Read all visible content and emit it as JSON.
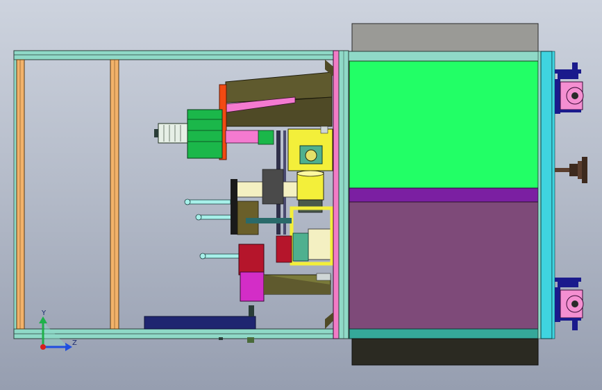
{
  "view": {
    "background_top": "#cdd3de",
    "background_bottom": "#969eb0"
  },
  "triad": {
    "y_label": "Y",
    "z_label": "Z",
    "colors": {
      "y_axis": "#1fb14a",
      "z_axis": "#1f4fe0",
      "origin": "#d81e1e"
    }
  },
  "palette": {
    "frame": "#8fd9c7",
    "frame_outline": "#2a3d38",
    "posts": "#f2b26a",
    "cabinet_green": "#22ff66",
    "cabinet_purple": "#7e4a79",
    "cabinet_violet": "#7b1fa2",
    "cabinet_dark": "#2b2a22",
    "cabinet_grey": "#9a9a96",
    "mounting_plate_pink": "#f27cc6",
    "mounting_plate_teal": "#3fd4e0",
    "caster_navy": "#1a1a8c",
    "caster_pink": "#f48fd1",
    "mech_olive": "#5f5a2e",
    "mech_pink": "#f47ad0",
    "mech_orange": "#f24a12",
    "mech_green": "#1bb74a",
    "mech_yellow": "#f3ef3a",
    "mech_magenta": "#d32dc7",
    "mech_red": "#b5152b",
    "mech_navy": "#1f2570",
    "mech_cream": "#f4f0c2"
  }
}
